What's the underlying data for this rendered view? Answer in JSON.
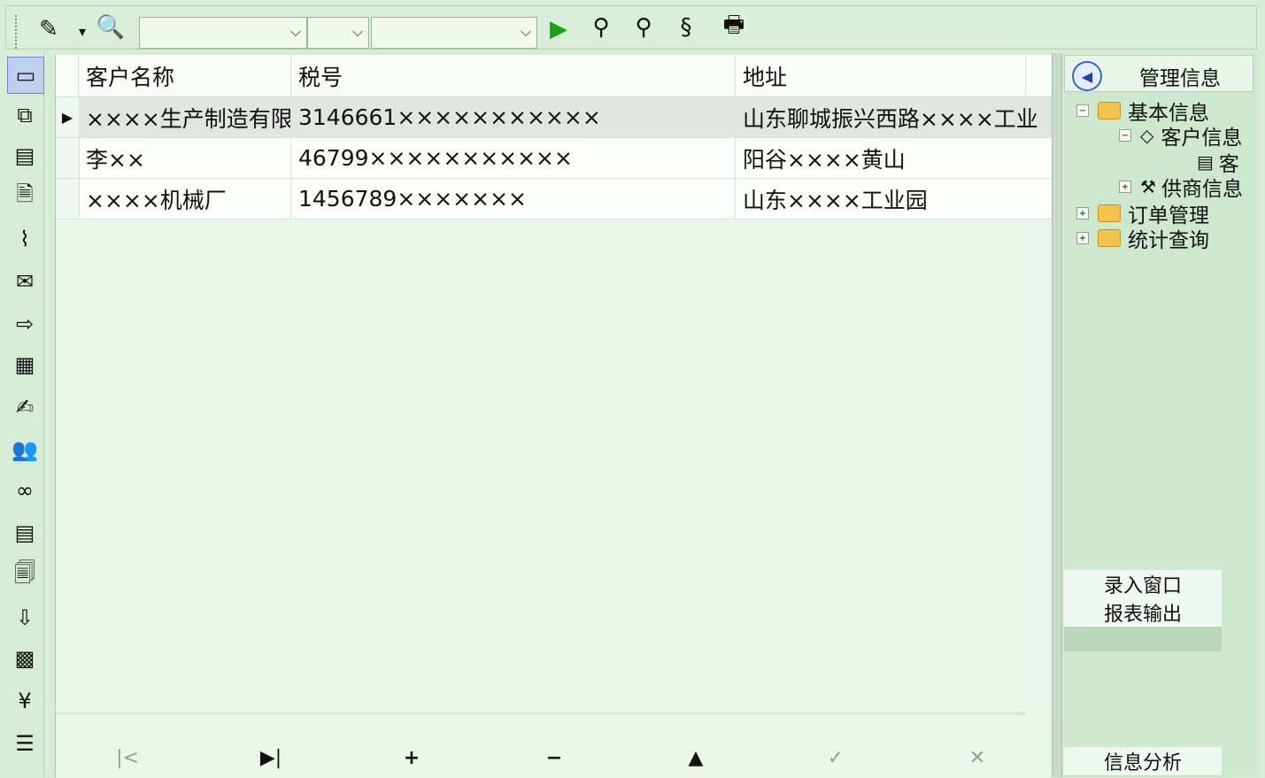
{
  "toolbar": {
    "icons": [
      "pencil-icon",
      "dropdown-arrow-icon",
      "search-document-icon",
      "run-icon",
      "find-user-icon",
      "find-icon",
      "refresh-icon",
      "print-icon"
    ],
    "combo1": "",
    "combo2": "",
    "combo3": ""
  },
  "leftbar": {
    "icons": [
      "window-icon",
      "flow-icon",
      "list-icon",
      "document-icon",
      "chart-icon",
      "mail-icon",
      "import-icon",
      "table-icon",
      "edit-icon",
      "users-icon",
      "network-icon",
      "report-icon",
      "file-icon",
      "export-icon",
      "grid-icon",
      "money-icon",
      "notes-icon"
    ]
  },
  "grid": {
    "columns": [
      "客户名称",
      "税号",
      "地址"
    ],
    "rows": [
      [
        "××××生产制造有限",
        "3146661×××××××××××",
        "山东聊城振兴西路××××工业"
      ],
      [
        "李××",
        "46799×××××××××××",
        "阳谷××××黄山"
      ],
      [
        "××××机械厂",
        "1456789×××××××",
        "山东××××工业园"
      ]
    ]
  },
  "navigator": {
    "first": "|<",
    "last": "▶|",
    "add": "+",
    "remove": "−",
    "up": "▲",
    "post": "✓",
    "cancel": "✕"
  },
  "right_panel": {
    "title": "管理信息",
    "tree": {
      "basic_info": "基本信息",
      "customer_info": "客户信息",
      "customer_sub": "客",
      "supplier_info": "供商信息",
      "order_mgmt": "订单管理",
      "stats_query": "统计查询"
    },
    "buttons": {
      "entry_window": "录入窗口",
      "report_output": "报表输出",
      "info_analysis": "信息分析"
    }
  }
}
